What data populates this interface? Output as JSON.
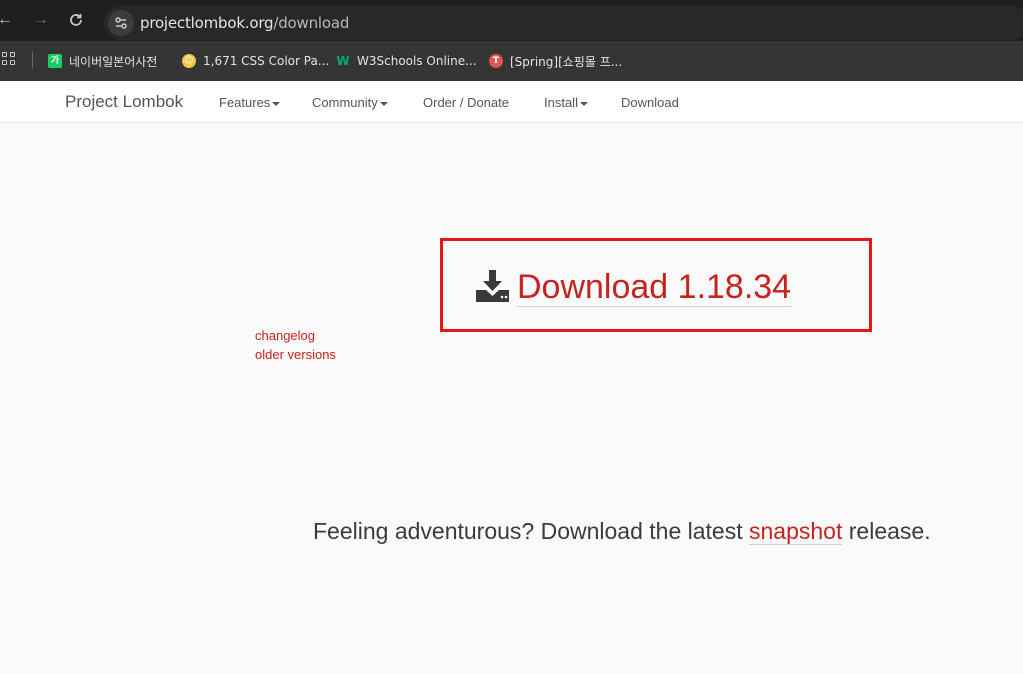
{
  "browser": {
    "url_host": "projectlombok.org",
    "url_path": "/download",
    "bookmarks": [
      {
        "icon": "naver-dictionary-icon",
        "label": "네이버일본어사전"
      },
      {
        "icon": "css-color-icon",
        "label": "1,671 CSS Color Pa..."
      },
      {
        "icon": "w3schools-icon",
        "label": "W3Schools Online..."
      },
      {
        "icon": "spring-icon",
        "label": "[Spring][쇼핑몰 프..."
      }
    ]
  },
  "site_nav": {
    "brand": "Project Lombok",
    "items": [
      "Features",
      "Community",
      "Order / Donate",
      "Install",
      "Download"
    ]
  },
  "main": {
    "download_label": "Download 1.18.34",
    "changelog_label": "changelog",
    "older_versions_label": "older versions",
    "snapshot_prefix": "Feeling adventurous? Download the latest ",
    "snapshot_link": "snapshot",
    "snapshot_suffix": " release."
  },
  "colors": {
    "link_red": "#c7221d",
    "highlight_box": "#e8141b",
    "chrome_dark": "#1f1f1f"
  }
}
